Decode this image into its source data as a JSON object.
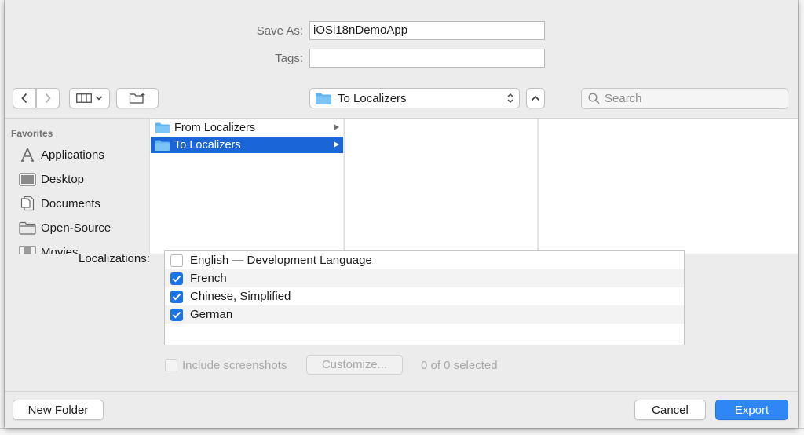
{
  "save_as": {
    "label": "Save As:",
    "value": "iOSi18nDemoApp"
  },
  "tags": {
    "label": "Tags:",
    "value": ""
  },
  "toolbar": {
    "back_icon": "chevron-left",
    "forward_icon": "chevron-right",
    "view_icon": "column-view",
    "new_folder_icon": "folder-plus",
    "location": "To Localizers",
    "expand_icon": "chevron-up",
    "search_placeholder": "Search"
  },
  "sidebar": {
    "heading": "Favorites",
    "items": [
      {
        "label": "Applications",
        "icon": "applications-icon"
      },
      {
        "label": "Desktop",
        "icon": "desktop-icon"
      },
      {
        "label": "Documents",
        "icon": "documents-icon"
      },
      {
        "label": "Open-Source",
        "icon": "folder-icon"
      },
      {
        "label": "Movies",
        "icon": "movies-icon"
      }
    ]
  },
  "files": [
    {
      "name": "From Localizers",
      "selected": false
    },
    {
      "name": "To Localizers",
      "selected": true
    }
  ],
  "localizations": {
    "label": "Localizations:",
    "items": [
      {
        "label": "English — Development Language",
        "checked": false
      },
      {
        "label": "French",
        "checked": true
      },
      {
        "label": "Chinese, Simplified",
        "checked": true
      },
      {
        "label": "German",
        "checked": true
      }
    ]
  },
  "screenshots": {
    "checkbox_label": "Include screenshots",
    "customize_label": "Customize...",
    "status": "0 of 0 selected"
  },
  "footer": {
    "new_folder": "New Folder",
    "cancel": "Cancel",
    "export": "Export"
  },
  "colors": {
    "accent": "#2f86f5",
    "selection": "#1a65d8",
    "folder": "#5fb3f1"
  }
}
